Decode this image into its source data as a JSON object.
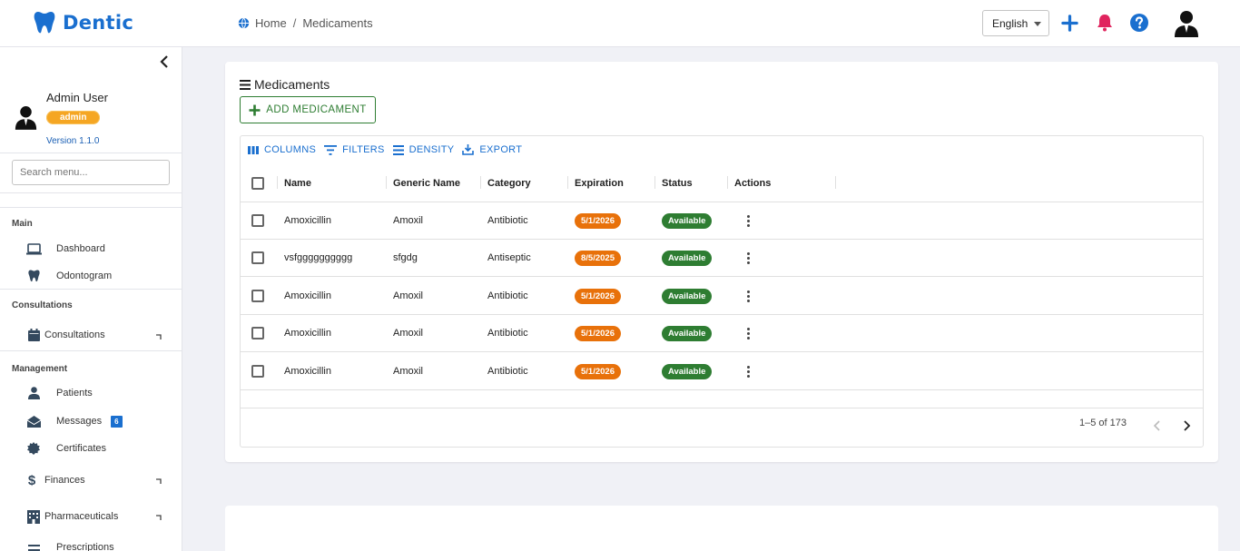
{
  "app": {
    "name": "Dentic",
    "brand_color": "#1a6fcf"
  },
  "header": {
    "breadcrumb": [
      "Home",
      "Medicaments"
    ],
    "language": "English"
  },
  "sidebar": {
    "user_name": "Admin User",
    "role": "admin",
    "version": "Version 1.1.0",
    "search_placeholder": "Search menu...",
    "sections": [
      {
        "title": "Main",
        "items": [
          {
            "label": "Dashboard",
            "icon": "laptop-icon"
          },
          {
            "label": "Odontogram",
            "icon": "tooth-icon"
          }
        ]
      },
      {
        "title": "Consultations",
        "items": [
          {
            "label": "Consultations",
            "icon": "calendar-icon",
            "expandable": true
          }
        ]
      },
      {
        "title": "Management",
        "items": [
          {
            "label": "Patients",
            "icon": "user-icon"
          },
          {
            "label": "Messages",
            "icon": "envelope-icon",
            "badge": "6"
          },
          {
            "label": "Certificates",
            "icon": "certificate-icon"
          },
          {
            "label": "Finances",
            "icon": "dollar-icon",
            "expandable": true
          },
          {
            "label": "Pharmaceuticals",
            "icon": "hospital-icon",
            "expandable": true
          },
          {
            "label": "Prescriptions",
            "icon": "list-icon"
          }
        ]
      }
    ]
  },
  "page": {
    "title": "Medicaments",
    "add_button": "ADD MEDICAMENT",
    "toolbar": {
      "columns": "COLUMNS",
      "filters": "FILTERS",
      "density": "DENSITY",
      "export": "EXPORT"
    },
    "columns": [
      "Name",
      "Generic Name",
      "Category",
      "Expiration",
      "Status",
      "Actions"
    ],
    "rows": [
      {
        "name": "Amoxicillin",
        "generic": "Amoxil",
        "category": "Antibiotic",
        "expiration": "5/1/2026",
        "status": "Available"
      },
      {
        "name": "vsfgggggggggg",
        "generic": "sfgdg",
        "category": "Antiseptic",
        "expiration": "8/5/2025",
        "status": "Available"
      },
      {
        "name": "Amoxicillin",
        "generic": "Amoxil",
        "category": "Antibiotic",
        "expiration": "5/1/2026",
        "status": "Available"
      },
      {
        "name": "Amoxicillin",
        "generic": "Amoxil",
        "category": "Antibiotic",
        "expiration": "5/1/2026",
        "status": "Available"
      },
      {
        "name": "Amoxicillin",
        "generic": "Amoxil",
        "category": "Antibiotic",
        "expiration": "5/1/2026",
        "status": "Available"
      }
    ],
    "pagination": "1–5 of 173"
  },
  "colors": {
    "expiration_pill": "#e8710a",
    "status_pill": "#2e7d32",
    "role_badge": "#f5a623",
    "notification": "#e0245e"
  }
}
